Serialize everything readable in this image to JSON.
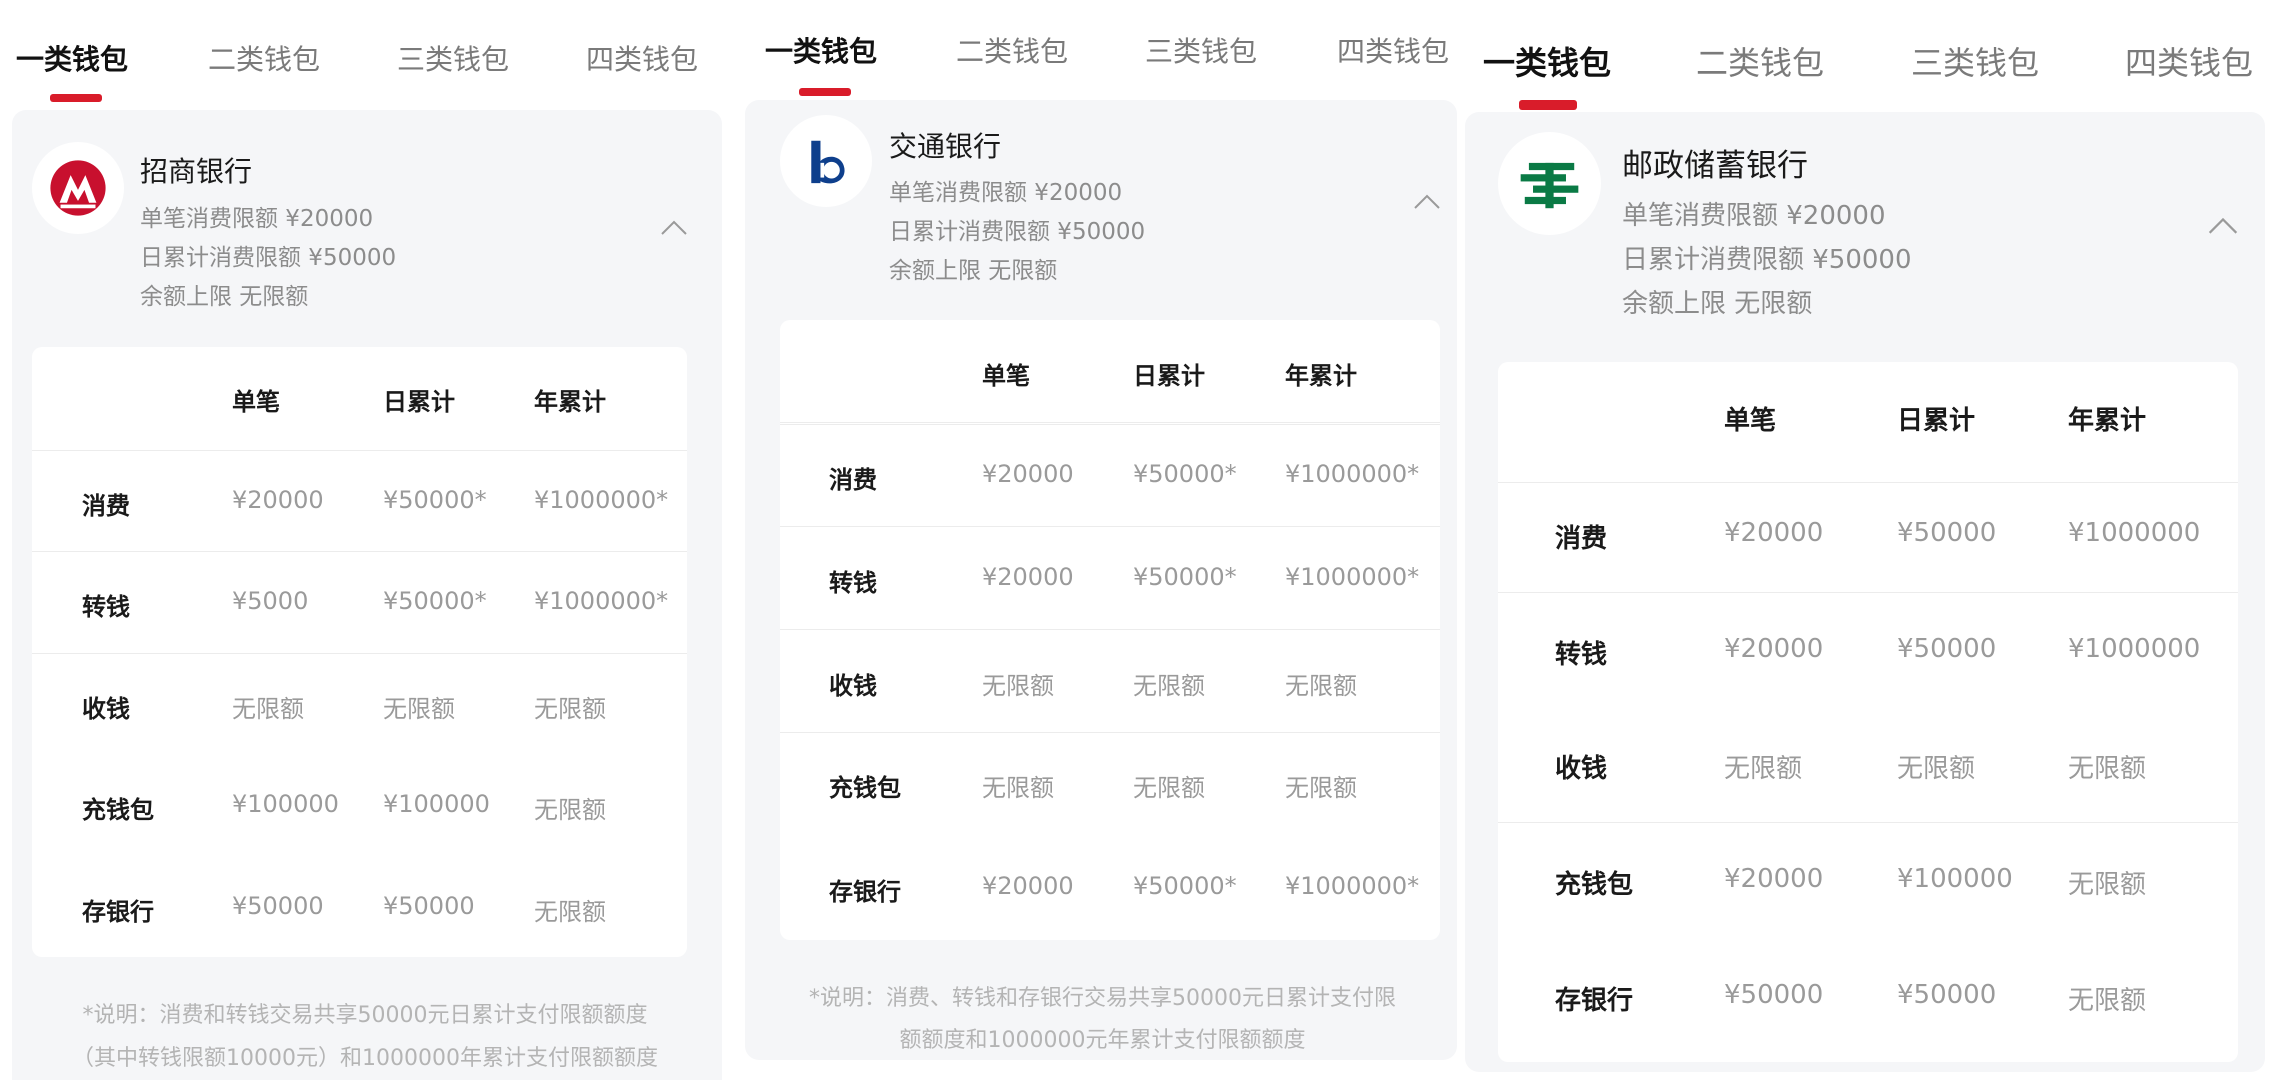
{
  "panels": [
    {
      "tabs": [
        {
          "label": "一类钱包",
          "active": true
        },
        {
          "label": "二类钱包",
          "active": false
        },
        {
          "label": "三类钱包",
          "active": false
        },
        {
          "label": "四类钱包",
          "active": false
        }
      ],
      "bank_name": "招商银行",
      "logo": "cmb-bank-logo",
      "info": [
        "单笔消费限额 ¥20000",
        "日累计消费限额 ¥50000",
        "余额上限 无限额"
      ],
      "columns": [
        "单笔",
        "日累计",
        "年累计"
      ],
      "rows": [
        {
          "label": "消费",
          "values": [
            "¥20000",
            "¥50000*",
            "¥1000000*"
          ]
        },
        {
          "label": "转钱",
          "values": [
            "¥5000",
            "¥50000*",
            "¥1000000*"
          ]
        },
        {
          "label": "收钱",
          "values": [
            "无限额",
            "无限额",
            "无限额"
          ]
        },
        {
          "label": "充钱包",
          "values": [
            "¥100000",
            "¥100000",
            "无限额"
          ]
        },
        {
          "label": "存银行",
          "values": [
            "¥50000",
            "¥50000",
            "无限额"
          ]
        }
      ],
      "note": [
        "*说明：消费和转钱交易共享50000元日累计支付限额额度",
        "（其中转钱限额10000元）和1000000年累计支付限额额度"
      ]
    },
    {
      "tabs": [
        {
          "label": "一类钱包",
          "active": true
        },
        {
          "label": "二类钱包",
          "active": false
        },
        {
          "label": "三类钱包",
          "active": false
        },
        {
          "label": "四类钱包",
          "active": false
        }
      ],
      "bank_name": "交通银行",
      "logo": "bocom-bank-logo",
      "info": [
        "单笔消费限额 ¥20000",
        "日累计消费限额 ¥50000",
        "余额上限 无限额"
      ],
      "columns": [
        "单笔",
        "日累计",
        "年累计"
      ],
      "rows": [
        {
          "label": "消费",
          "values": [
            "¥20000",
            "¥50000*",
            "¥1000000*"
          ]
        },
        {
          "label": "转钱",
          "values": [
            "¥20000",
            "¥50000*",
            "¥1000000*"
          ]
        },
        {
          "label": "收钱",
          "values": [
            "无限额",
            "无限额",
            "无限额"
          ]
        },
        {
          "label": "充钱包",
          "values": [
            "无限额",
            "无限额",
            "无限额"
          ]
        },
        {
          "label": "存银行",
          "values": [
            "¥20000",
            "¥50000*",
            "¥1000000*"
          ]
        }
      ],
      "note": [
        "*说明：消费、转钱和存银行交易共享50000元日累计支付限",
        "额额度和1000000元年累计支付限额额度"
      ]
    },
    {
      "tabs": [
        {
          "label": "一类钱包",
          "active": true
        },
        {
          "label": "二类钱包",
          "active": false
        },
        {
          "label": "三类钱包",
          "active": false
        },
        {
          "label": "四类钱包",
          "active": false
        }
      ],
      "bank_name": "邮政储蓄银行",
      "logo": "psbc-bank-logo",
      "info": [
        "单笔消费限额 ¥20000",
        "日累计消费限额 ¥50000",
        "余额上限 无限额"
      ],
      "columns": [
        "单笔",
        "日累计",
        "年累计"
      ],
      "rows": [
        {
          "label": "消费",
          "values": [
            "¥20000",
            "¥50000",
            "¥1000000"
          ]
        },
        {
          "label": "转钱",
          "values": [
            "¥20000",
            "¥50000",
            "¥1000000"
          ]
        },
        {
          "label": "收钱",
          "values": [
            "无限额",
            "无限额",
            "无限额"
          ]
        },
        {
          "label": "充钱包",
          "values": [
            "¥20000",
            "¥100000",
            "无限额"
          ]
        },
        {
          "label": "存银行",
          "values": [
            "¥50000",
            "¥50000",
            "无限额"
          ]
        }
      ],
      "note": []
    }
  ],
  "colors": {
    "accent": "#d91c2a",
    "cmb_red": "#c8102e",
    "bocom_blue": "#0e3f8c",
    "psbc_green": "#0a7a45"
  }
}
